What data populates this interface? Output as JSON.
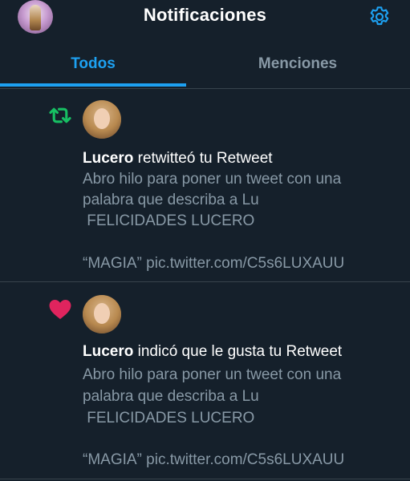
{
  "header": {
    "title": "Notificaciones"
  },
  "tabs": [
    {
      "label": "Todos",
      "active": true
    },
    {
      "label": "Menciones",
      "active": false
    }
  ],
  "notifications": [
    {
      "type_icon": "retweet-icon",
      "icon_color": "#17bf63",
      "user": "Lucero",
      "action": " retwitteó tu Retweet",
      "lines": [
        "Abro hilo para poner un tweet con una",
        "palabra que describa a Lu",
        " FELICIDADES LUCERO",
        "“MAGIA” pic.twitter.com/C5s6LUXAUU"
      ]
    },
    {
      "type_icon": "heart-icon",
      "icon_color": "#e0245e",
      "user": "Lucero",
      "action": " indicó que le gusta tu Retweet",
      "lines": [
        "Abro hilo para poner un tweet con una",
        "palabra que describa a Lu",
        " FELICIDADES LUCERO",
        "“MAGIA” pic.twitter.com/C5s6LUXAUU"
      ]
    }
  ],
  "colors": {
    "background": "#15202b",
    "accent": "#1da1f2",
    "secondary_text": "#8899a6",
    "border": "#38444d"
  }
}
